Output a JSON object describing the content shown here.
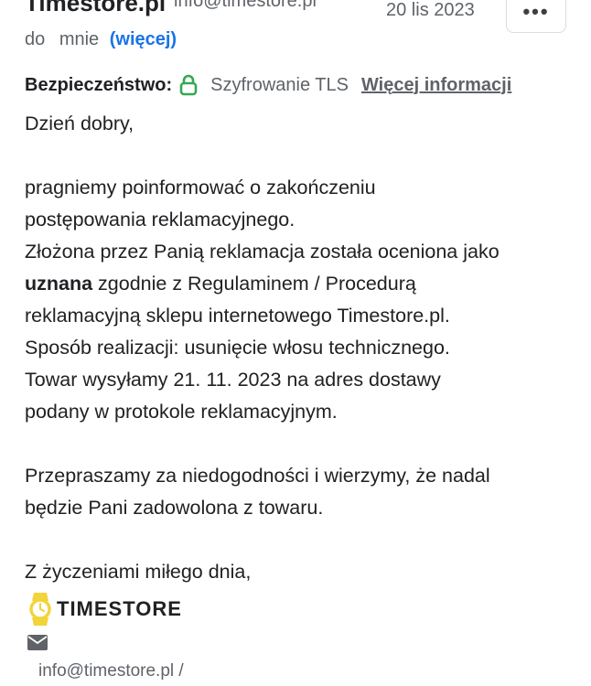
{
  "header": {
    "sender_name": "Timestore.pl",
    "sender_email": "info@timestore.pl",
    "date": "20 lis 2023",
    "more_button": "•••",
    "to_label": "do",
    "to_value": "mnie",
    "more_link": "(więcej)"
  },
  "security": {
    "label": "Bezpieczeństwo:",
    "icon": "lock-icon",
    "icon_color": "#34a853",
    "text": "Szyfrowanie TLS",
    "link": "Więcej informacji"
  },
  "body": {
    "greeting": "Dzień dobry,",
    "p1_line1": "pragniemy poinformować o zakończeniu",
    "p1_line2": "postępowania reklamacyjnego.",
    "p1_line3": "Złożona przez Panią reklamacja została oceniona jako",
    "p1_bold": "uznana",
    "p1_line4_rest": " zgodnie z Regulaminem / Procedurą",
    "p1_line5": "reklamacyjną sklepu internetowego Timestore.pl.",
    "p1_line6": "Sposób realizacji: usunięcie włosu technicznego.",
    "p1_line7": "Towar wysyłamy 21. 11. 2023 na adres dostawy",
    "p1_line8": "podany w protokole reklamacyjnym.",
    "p2_line1": "Przepraszamy za niedogodności i wierzymy, że nadal",
    "p2_line2": "będzie Pani zadowolona z towaru.",
    "closing": "Z życzeniami miłego dnia,"
  },
  "signature": {
    "logo_icon": "watch-icon",
    "logo_color": "#f2d43a",
    "logo_text": "TIMESTORE",
    "mail_icon": "envelope-icon",
    "email": "info@timestore.pl /"
  }
}
